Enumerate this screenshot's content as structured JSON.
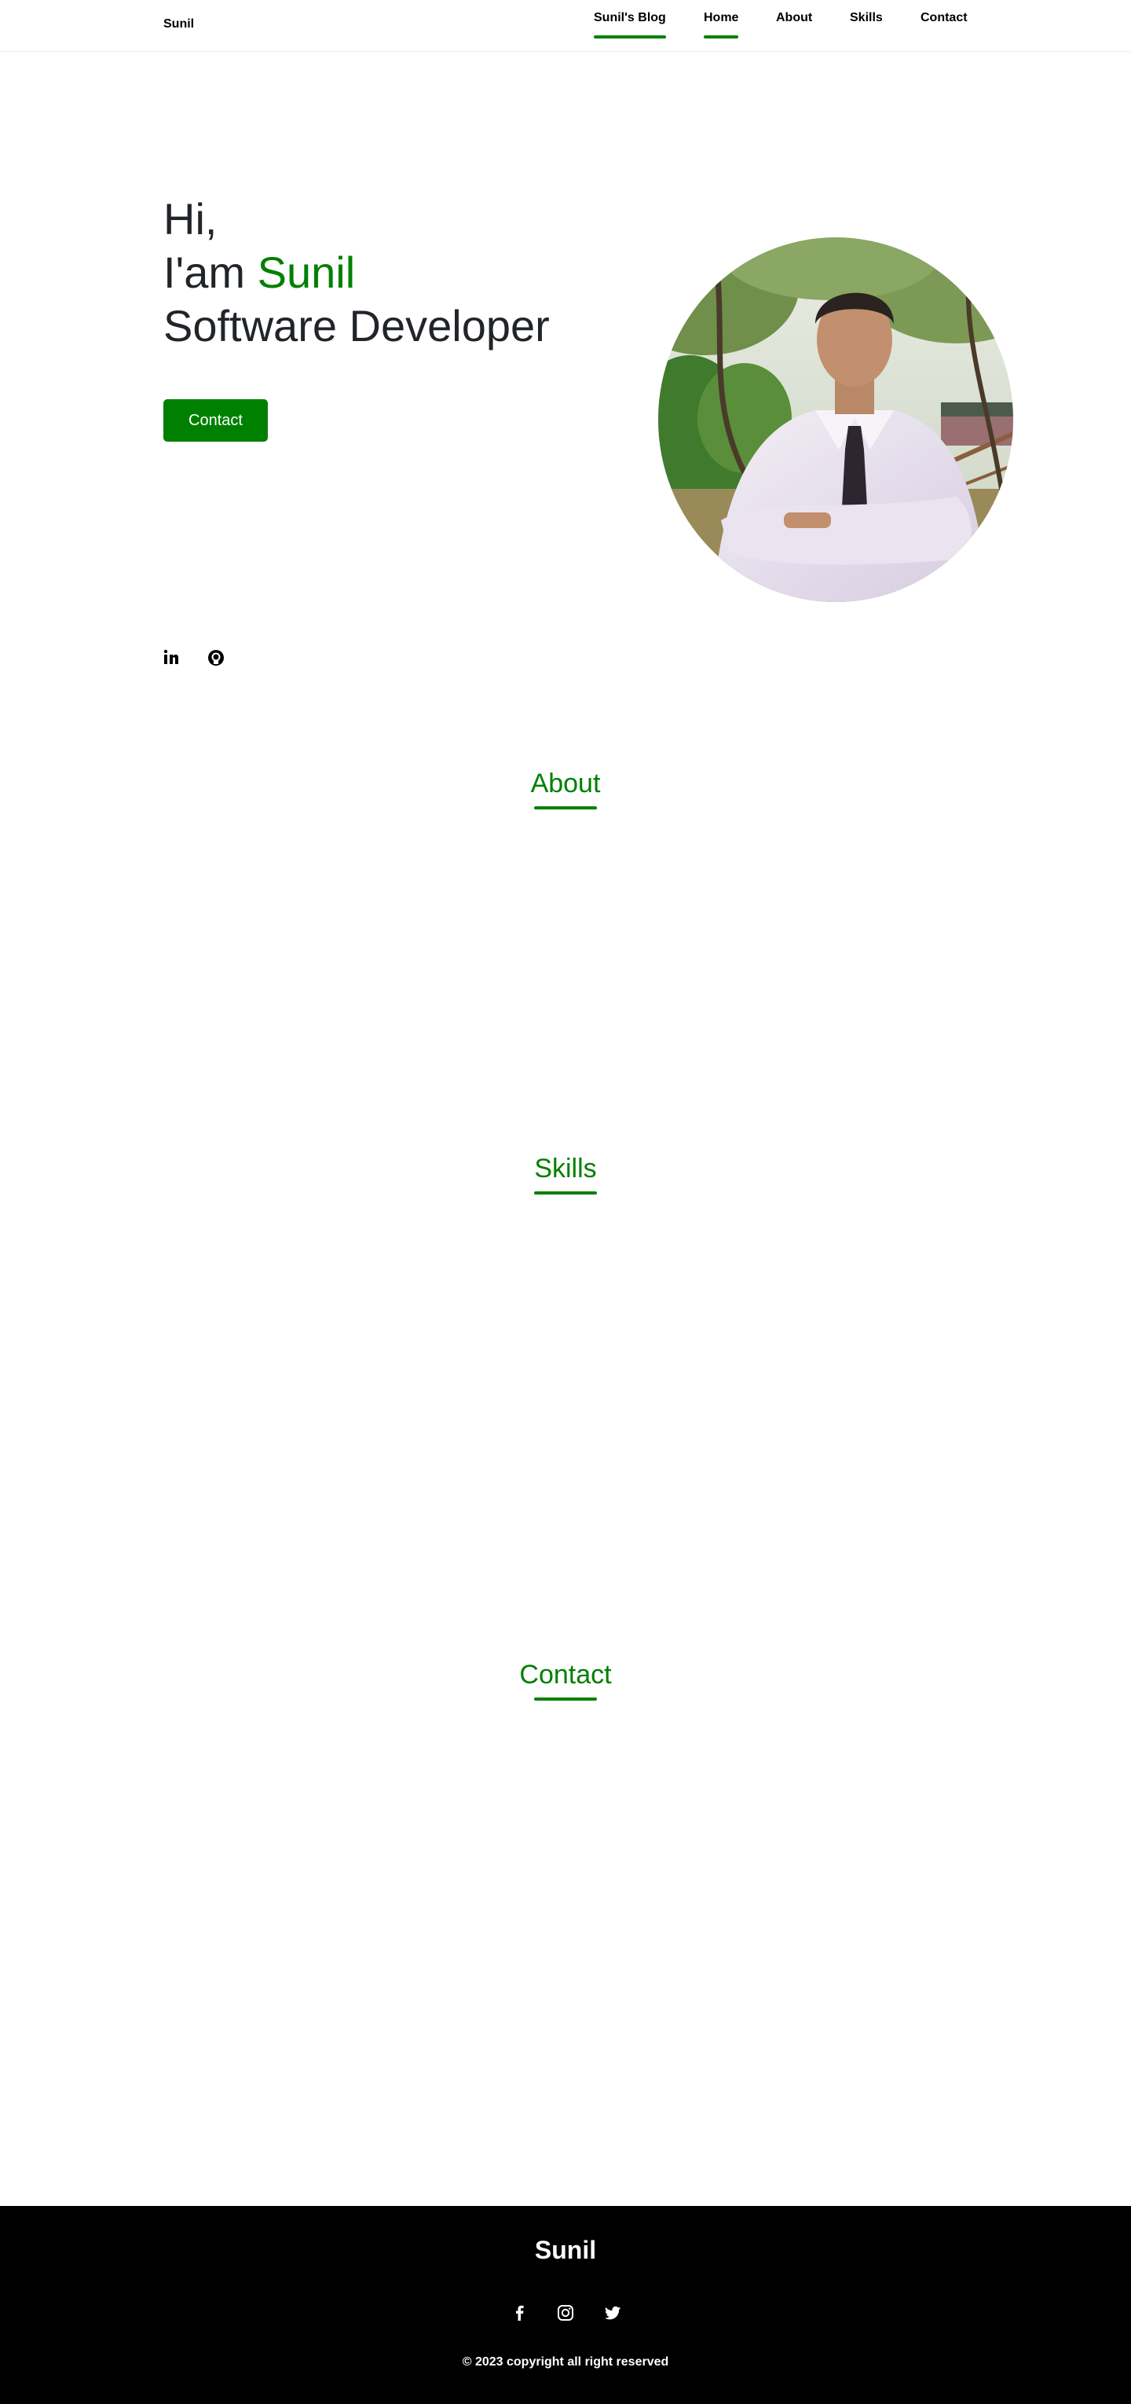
{
  "header": {
    "logo": "Sunil",
    "nav": [
      {
        "label": "Sunil's Blog"
      },
      {
        "label": "Home"
      },
      {
        "label": "About"
      },
      {
        "label": "Skills"
      },
      {
        "label": "Contact"
      }
    ]
  },
  "hero": {
    "line1": "Hi,",
    "line2_prefix": "I'am ",
    "line2_name": "Sunil",
    "line3": "Software Developer",
    "button": "Contact"
  },
  "social": {
    "icons": [
      "linkedin-icon",
      "github-icon"
    ]
  },
  "sections": {
    "about": "About",
    "skills": "Skills",
    "contact": "Contact"
  },
  "footer": {
    "name": "Sunil",
    "icons": [
      "facebook-icon",
      "instagram-icon",
      "twitter-icon"
    ],
    "copyright": "© 2023 copyright all right reserved"
  },
  "colors": {
    "accent": "#008000",
    "text": "#212529",
    "footer_bg": "#000000"
  }
}
